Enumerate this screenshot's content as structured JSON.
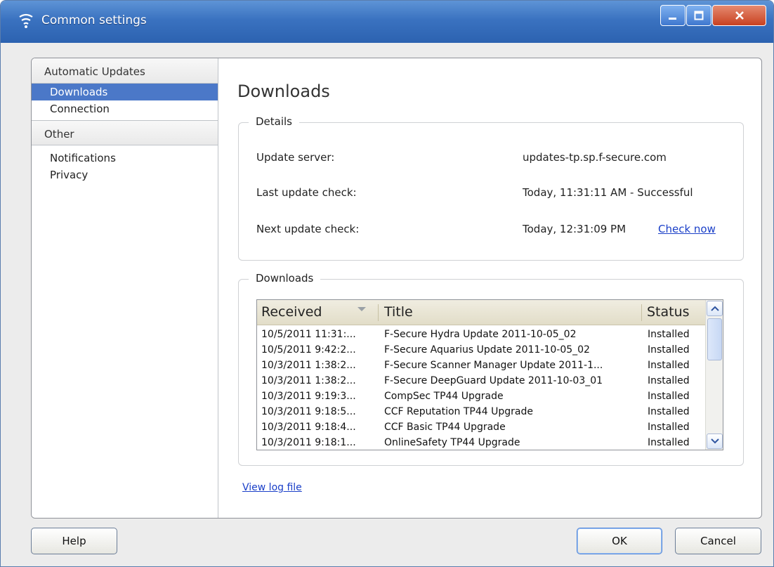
{
  "window": {
    "title": "Common settings"
  },
  "sidebar": {
    "groups": [
      {
        "label": "Automatic Updates",
        "items": [
          {
            "label": "Downloads",
            "selected": true
          },
          {
            "label": "Connection",
            "selected": false
          }
        ]
      },
      {
        "label": "Other",
        "items": [
          {
            "label": "Notifications",
            "selected": false
          },
          {
            "label": "Privacy",
            "selected": false
          }
        ]
      }
    ]
  },
  "main": {
    "title": "Downloads",
    "details": {
      "label": "Details",
      "update_server_label": "Update server:",
      "update_server_value": "updates-tp.sp.f-secure.com",
      "last_check_label": "Last update check:",
      "last_check_value": "Today, 11:31:11 AM - Successful",
      "next_check_label": "Next update check:",
      "next_check_value": "Today, 12:31:09 PM",
      "check_now": "Check now"
    },
    "downloads": {
      "label": "Downloads",
      "columns": [
        "Received",
        "Title",
        "Status"
      ],
      "rows": [
        [
          "10/5/2011 11:31:...",
          "F-Secure Hydra Update 2011-10-05_02",
          "Installed"
        ],
        [
          "10/5/2011 9:42:2...",
          "F-Secure Aquarius Update 2011-10-05_02",
          "Installed"
        ],
        [
          "10/3/2011 1:38:2...",
          "F-Secure Scanner Manager Update 2011-1...",
          "Installed"
        ],
        [
          "10/3/2011 1:38:2...",
          "F-Secure DeepGuard Update 2011-10-03_01",
          "Installed"
        ],
        [
          "10/3/2011 9:19:3...",
          "CompSec TP44 Upgrade",
          "Installed"
        ],
        [
          "10/3/2011 9:18:5...",
          "CCF Reputation TP44 Upgrade",
          "Installed"
        ],
        [
          "10/3/2011 9:18:4...",
          "CCF Basic TP44 Upgrade",
          "Installed"
        ],
        [
          "10/3/2011 9:18:1...",
          "OnlineSafety TP44 Upgrade",
          "Installed"
        ]
      ]
    },
    "view_log": "View log file"
  },
  "buttons": {
    "help": "Help",
    "ok": "OK",
    "cancel": "Cancel"
  },
  "colors": {
    "titlebar": "#3a72c0",
    "selection": "#4b78c8",
    "link": "#1a3fc8"
  }
}
